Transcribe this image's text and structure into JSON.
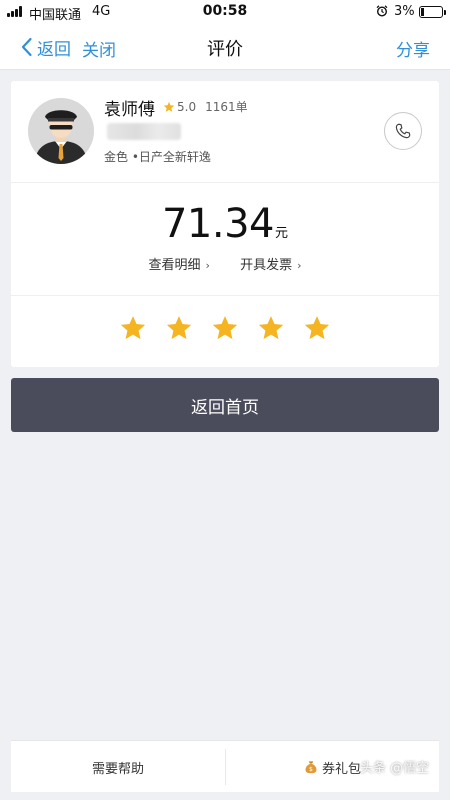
{
  "status_bar": {
    "carrier": "中国联通",
    "network": "4G",
    "time": "00:58",
    "battery": "3%",
    "battery_level_fraction": 0.03
  },
  "nav": {
    "back_label": "返回",
    "close_label": "关闭",
    "title": "评价",
    "share_label": "分享"
  },
  "driver": {
    "name": "袁师傅",
    "rating": "5.0",
    "orders": "1161单",
    "car": "金色 •日产全新轩逸"
  },
  "fare": {
    "amount": "71.34",
    "unit": "元",
    "details_label": "查看明细",
    "invoice_label": "开具发票"
  },
  "rating_stars": {
    "selected": 5,
    "total": 5
  },
  "actions": {
    "home_label": "返回首页",
    "help_label": "需要帮助",
    "coupon_label": "券礼包"
  },
  "watermark": "头条 @悟空",
  "colors": {
    "accent": "#2f8fd8",
    "star": "#f5b523",
    "home_button": "#4b4c5b",
    "background": "#eef0f4"
  },
  "icons": [
    "signal-icon",
    "alarm-icon",
    "battery-icon",
    "chevron-left-icon",
    "star-icon",
    "phone-icon",
    "avatar-driver",
    "money-bag-icon"
  ]
}
